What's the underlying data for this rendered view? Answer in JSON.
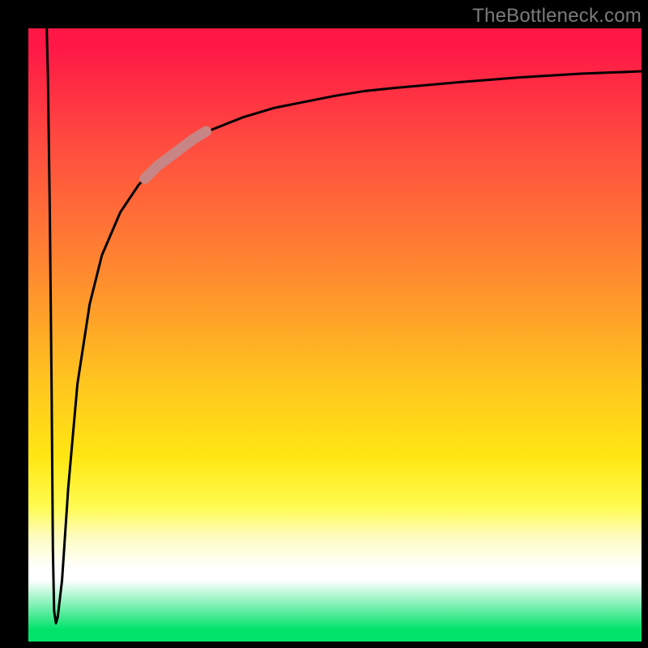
{
  "watermark": "TheBottleneck.com",
  "colors": {
    "background": "#000000",
    "gradient_top": "#ff1846",
    "gradient_mid1": "#ff8a2f",
    "gradient_mid2": "#ffe713",
    "gradient_white": "#ffffff",
    "gradient_bottom": "#02e36b",
    "curve": "#000000",
    "highlight": "#c88585"
  },
  "chart_data": {
    "type": "line",
    "title": "",
    "xlabel": "",
    "ylabel": "",
    "xlim": [
      0,
      100
    ],
    "ylim": [
      0,
      100
    ],
    "series": [
      {
        "name": "spike-down",
        "x": [
          3.0,
          3.2,
          3.5,
          3.8,
          4.0,
          4.2,
          4.5,
          4.8
        ],
        "y": [
          100,
          92,
          70,
          40,
          15,
          5,
          3,
          4
        ]
      },
      {
        "name": "rising-curve",
        "x": [
          4.8,
          5.5,
          6.5,
          8,
          10,
          12,
          15,
          18,
          21,
          24,
          27,
          30,
          35,
          40,
          45,
          50,
          55,
          60,
          70,
          80,
          90,
          100
        ],
        "y": [
          4,
          10,
          25,
          42,
          55,
          63,
          70,
          74.5,
          77.5,
          80,
          82,
          83.5,
          85.5,
          87,
          88,
          89,
          89.8,
          90.3,
          91.2,
          92,
          92.6,
          93
        ]
      },
      {
        "name": "highlight-segment",
        "x": [
          19,
          21,
          23,
          25,
          27,
          29
        ],
        "y": [
          75.5,
          77.5,
          79,
          80.5,
          82,
          83.2
        ]
      }
    ],
    "legend": [],
    "grid": false,
    "annotations": [
      {
        "text": "TheBottleneck.com",
        "position": "top-right"
      }
    ]
  }
}
